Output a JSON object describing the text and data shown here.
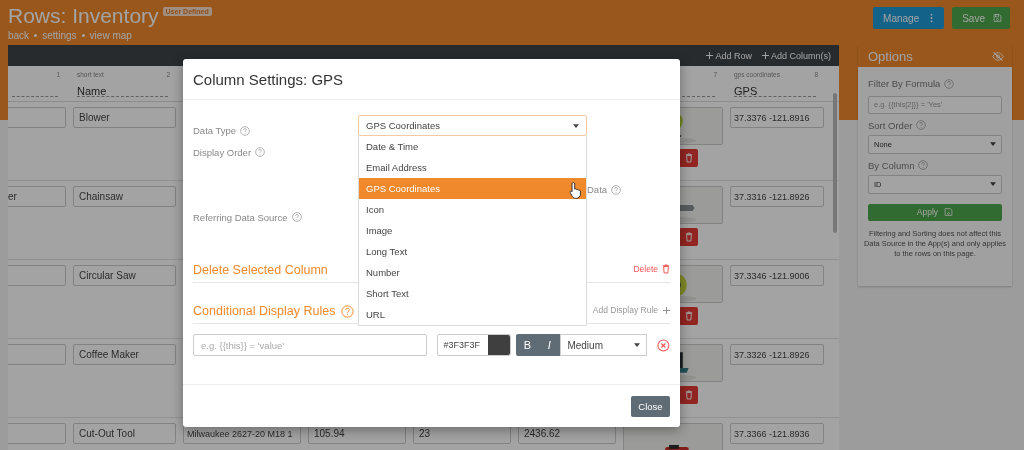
{
  "page": {
    "title": "Rows: Inventory",
    "badge": "User Defined",
    "breadcrumbs": [
      "back",
      "settings",
      "view map"
    ]
  },
  "actions": [
    {
      "kind": "manage",
      "label": "Manage"
    },
    {
      "kind": "save",
      "label": "Save"
    }
  ],
  "table": {
    "toolbar": [
      "Add Row",
      "Add Column(s)"
    ],
    "columns": [
      {
        "number": "1"
      },
      {
        "type": "short text",
        "name": "Name",
        "number": "2"
      },
      null,
      null,
      null,
      null,
      {
        "number": "7"
      },
      {
        "type": "gps coordinates",
        "name": "GPS",
        "number": "8"
      }
    ],
    "rows": [
      {
        "cells": [
          {
            "kind": "blank"
          },
          "Blower",
          null,
          null,
          null,
          null,
          {
            "kind": "picture",
            "deletable": true
          },
          "37.3376 -121.8916"
        ]
      },
      {
        "cells": [
          "er",
          "Chainsaw",
          null,
          null,
          null,
          null,
          {
            "kind": "picture",
            "deletable": true
          },
          "37.3316 -121.8926"
        ]
      },
      {
        "cells": [
          {
            "kind": "blank"
          },
          "Circular Saw",
          null,
          null,
          null,
          null,
          {
            "kind": "picture",
            "deletable": true
          },
          "37.3346 -121.9006"
        ]
      },
      {
        "cells": [
          {
            "kind": "blank"
          },
          "Coffee Maker",
          null,
          null,
          null,
          null,
          {
            "kind": "picture",
            "deletable": true
          },
          "37.3326 -121.8926"
        ]
      },
      {
        "cells": [
          {
            "kind": "blank"
          },
          "Cut-Out Tool",
          "Milwaukee 2627-20 M18 1",
          "105.94",
          "23",
          "2436.62",
          {
            "kind": "picture"
          },
          "37.3366 -121.8936"
        ]
      }
    ]
  },
  "options": {
    "title": "Options",
    "filter": {
      "label": "Filter By Formula",
      "placeholder": "e.g. {{this[2]}} = 'Yes'"
    },
    "sort_order": {
      "label": "Sort Order",
      "value": "None"
    },
    "by_column": {
      "label": "By Column",
      "value": "ID"
    },
    "apply": "Apply",
    "note": "Filtering and Sorting does not affect this Data Source in the App(s) and only applies to the rows on this page."
  },
  "modal": {
    "title": "Column Settings: GPS",
    "fields": [
      {
        "label": "Data Type"
      },
      {
        "label": "Display Order"
      },
      {
        "label": "Referring Data Source"
      }
    ],
    "data_type": {
      "value": "GPS Coordinates",
      "expanded": true,
      "options": [
        {
          "label": "Date & Time",
          "selected": false
        },
        {
          "label": "Email Address",
          "selected": false
        },
        {
          "label": "GPS Coordinates",
          "selected": true
        },
        {
          "label": "Icon",
          "selected": false
        },
        {
          "label": "Image",
          "selected": false
        },
        {
          "label": "Long Text",
          "selected": false
        },
        {
          "label": "Number",
          "selected": false
        },
        {
          "label": "Short Text",
          "selected": false
        },
        {
          "label": "URL",
          "selected": false
        }
      ]
    },
    "partial_label": "Data",
    "delete_section": {
      "title": "Delete Selected Column",
      "action": "Delete"
    },
    "rules_section": {
      "title": "Conditional Display Rules",
      "action": "Add Display Rule"
    },
    "rule": {
      "placeholder": "e.g. {{this}} = 'value'",
      "color_text": "#3F3F3F",
      "bold": "B",
      "italic": "I",
      "size": "Medium"
    },
    "close": "Close"
  }
}
